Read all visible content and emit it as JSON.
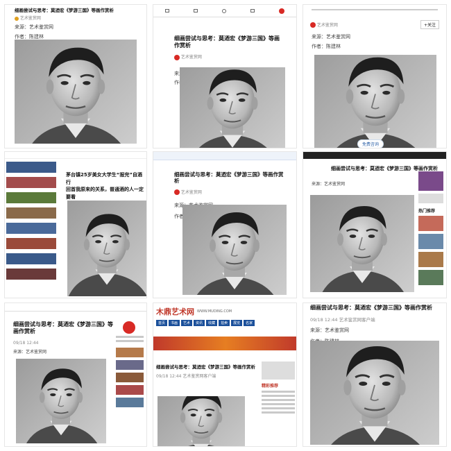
{
  "article": {
    "title": "细画尝试与思考：莫迺宏《梦游三国》等画作赏析",
    "title_wrap_a": "细画尝试与思考：莫迺宏《梦游三国》等",
    "title_wrap_b": "画作赏析",
    "source_label": "来源：艺术鉴赏网",
    "author_label": "作者：陈建林",
    "time_full": "09/18 12:44",
    "time_source": "09/18 12:44 艺术鉴赏网客户端",
    "publisher": "艺术鉴赏网",
    "follow": "+关注",
    "tile1_heading": "细画尝试与思考：莫迺宏《梦游三国》等画作赏析",
    "tile1_source": "来源：艺术鉴赏网",
    "tile1_author": "作者：陈建林",
    "tile3_source": "来源：艺术鉴赏网",
    "tile3_author": "作者：陈建林",
    "tile4_headline": "茅台镇25岁美女大学生“报完”自酒行",
    "tile4_headline2": "回首我原来的关系，普通酒的人一定要看",
    "tile5_source": "来源：艺术鉴赏网",
    "tile5_author": "作者：陈建林",
    "tile6_source": "来源：艺术鉴赏网",
    "tile7_source": "来源：艺术鉴赏网",
    "tile8_site": "木鼎艺术网",
    "tile8_site_sub": "WWW.MUDING.COM",
    "tile8_nav": [
      "首页",
      "书画",
      "艺术",
      "资讯",
      "收藏",
      "拍卖",
      "展览",
      "名家"
    ],
    "tile8_side_head": "精彩推荐",
    "tile6_side_head": "热门推荐",
    "tile3_badge": "免费咨询"
  },
  "colors": {
    "accent_red": "#d82a25",
    "nav_dark": "#222222",
    "nav_blue": "#1a4f9a"
  }
}
